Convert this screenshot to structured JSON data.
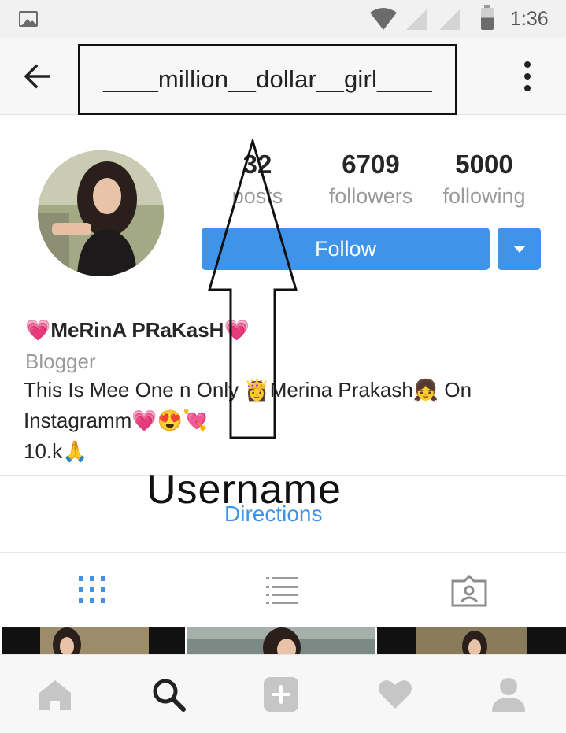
{
  "status_bar": {
    "time": "1:36"
  },
  "header": {
    "username": "____million__dollar__girl____"
  },
  "stats": [
    {
      "value": "32",
      "label": "posts"
    },
    {
      "value": "6709",
      "label": "followers"
    },
    {
      "value": "5000",
      "label": "following"
    }
  ],
  "actions": {
    "follow_label": "Follow"
  },
  "bio": {
    "heart_left": "💗",
    "name": "MeRinA PRaKasH",
    "heart_right": "💗",
    "category": "Blogger",
    "line1": "This Is Mee One n Only 👸Merina Prakash👧  On",
    "line2": "Instagramm💗😍💘",
    "line3": "10.k🙏"
  },
  "annotation": {
    "text": "Username"
  },
  "directions_label": "Directions",
  "colors": {
    "accent": "#3f93e8",
    "heart": "#e0447e"
  },
  "icons": {
    "status": [
      "gallery-icon",
      "wifi-icon",
      "signal-icon",
      "signal-icon",
      "battery-icon"
    ],
    "tabs": [
      "grid-icon",
      "list-icon",
      "tagged-icon"
    ],
    "bottom_nav": [
      "home-icon",
      "search-icon",
      "add-icon",
      "heart-icon",
      "profile-icon"
    ]
  }
}
